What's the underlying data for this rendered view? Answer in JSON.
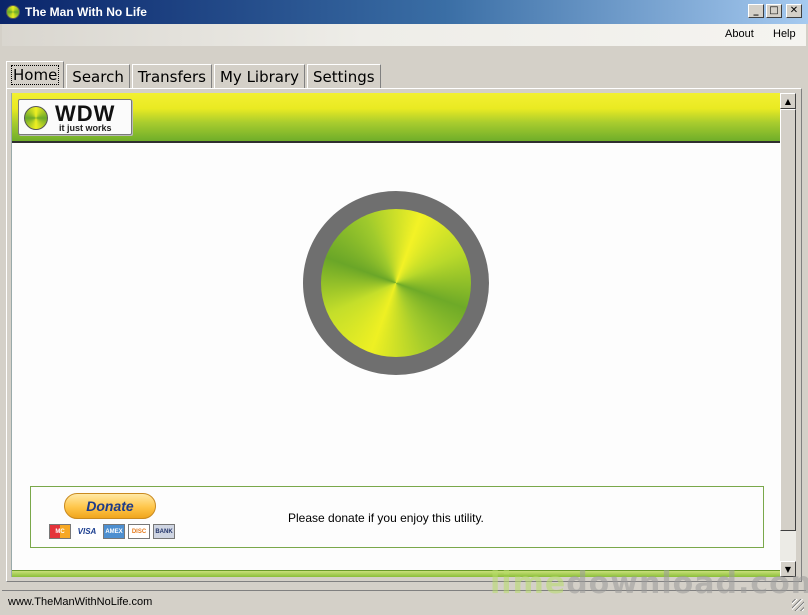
{
  "window": {
    "title": "The Man With No Life",
    "controls": {
      "minimize": "_",
      "maximize": "□",
      "close": "✕"
    }
  },
  "menu": {
    "about": "About",
    "help": "Help"
  },
  "tabs": [
    {
      "label": "Home",
      "active": true
    },
    {
      "label": "Search",
      "active": false
    },
    {
      "label": "Transfers",
      "active": false
    },
    {
      "label": "My Library",
      "active": false
    },
    {
      "label": "Settings",
      "active": false
    }
  ],
  "banner": {
    "logo_name": "WDW",
    "logo_tagline": "it just works"
  },
  "donate": {
    "button_label": "Donate",
    "cards": [
      "MC",
      "VISA",
      "AMEX",
      "DISC",
      "BANK"
    ],
    "message": "Please donate if you enjoy this utility."
  },
  "status": {
    "text": "www.TheManWithNoLife.com"
  },
  "watermark": {
    "part1": "lime",
    "part2": "download.com"
  },
  "colors": {
    "accent_yellow": "#eaea22",
    "accent_green": "#6fae2a",
    "ring_gray": "#6f6f6f"
  },
  "icons": {
    "app": "lime-ball-icon",
    "scroll_up": "arrow-up-icon",
    "scroll_down": "arrow-down-icon"
  }
}
